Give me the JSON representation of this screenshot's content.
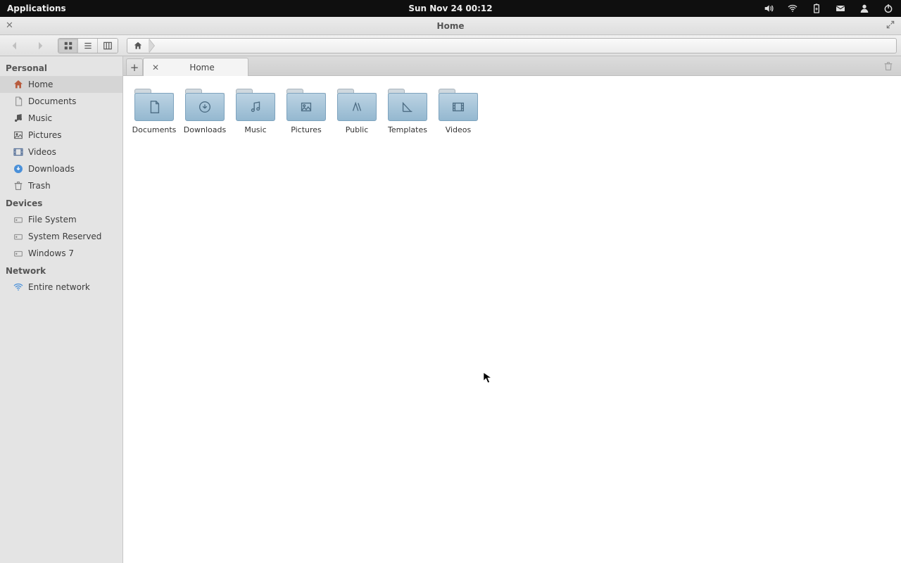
{
  "panel": {
    "applications": "Applications",
    "clock": "Sun  Nov 24  00:12"
  },
  "window": {
    "title": "Home"
  },
  "tabs": {
    "current": "Home"
  },
  "sidebar": {
    "g0": {
      "title": "Personal",
      "items": [
        "Home",
        "Documents",
        "Music",
        "Pictures",
        "Videos",
        "Downloads",
        "Trash"
      ]
    },
    "g1": {
      "title": "Devices",
      "items": [
        "File System",
        "System Reserved",
        "Windows 7"
      ]
    },
    "g2": {
      "title": "Network",
      "items": [
        "Entire network"
      ]
    }
  },
  "folders": [
    "Documents",
    "Downloads",
    "Music",
    "Pictures",
    "Public",
    "Templates",
    "Videos"
  ]
}
